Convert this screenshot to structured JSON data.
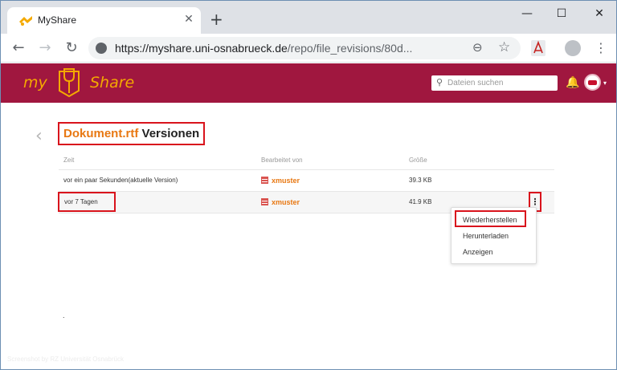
{
  "browser": {
    "tab_title": "MyShare",
    "tab_close": "✕",
    "new_tab": "+",
    "window": {
      "minimize": "—",
      "maximize": "☐",
      "close": "✕"
    },
    "nav": {
      "back": "←",
      "forward": "→",
      "reload": "↻"
    },
    "url_host": "https://myshare.uni-osnabrueck.de",
    "url_path": "/repo/file_revisions/80d...",
    "zoom": "⊖",
    "star": "☆",
    "menu": "⋮"
  },
  "app": {
    "brand_left": "my",
    "brand_right": "Share",
    "search_placeholder": "Dateien suchen",
    "search_icon": "⚲",
    "bell": "🔔",
    "caret": "▾",
    "colors": {
      "header": "#a0173f",
      "accent": "#f4a900",
      "link": "#e87812",
      "annotation": "#d9131c"
    }
  },
  "page": {
    "back": "‹",
    "file_name": "Dokument.rtf",
    "title_suffix": "Versionen",
    "columns": {
      "time": "Zeit",
      "editor": "Bearbeitet von",
      "size": "Größe"
    },
    "rows": [
      {
        "time": "vor ein paar Sekunden(aktuelle Version)",
        "editor": "xmuster",
        "size": "39.3 KB"
      },
      {
        "time": "vor 7 Tagen",
        "editor": "xmuster",
        "size": "41.9 KB"
      }
    ],
    "row_menu": "⋮",
    "menu_items": [
      "Wiederherstellen",
      "Herunterladen",
      "Anzeigen"
    ],
    "stray": ".",
    "footer": "Screenshot by RZ Universität Osnabrück"
  }
}
